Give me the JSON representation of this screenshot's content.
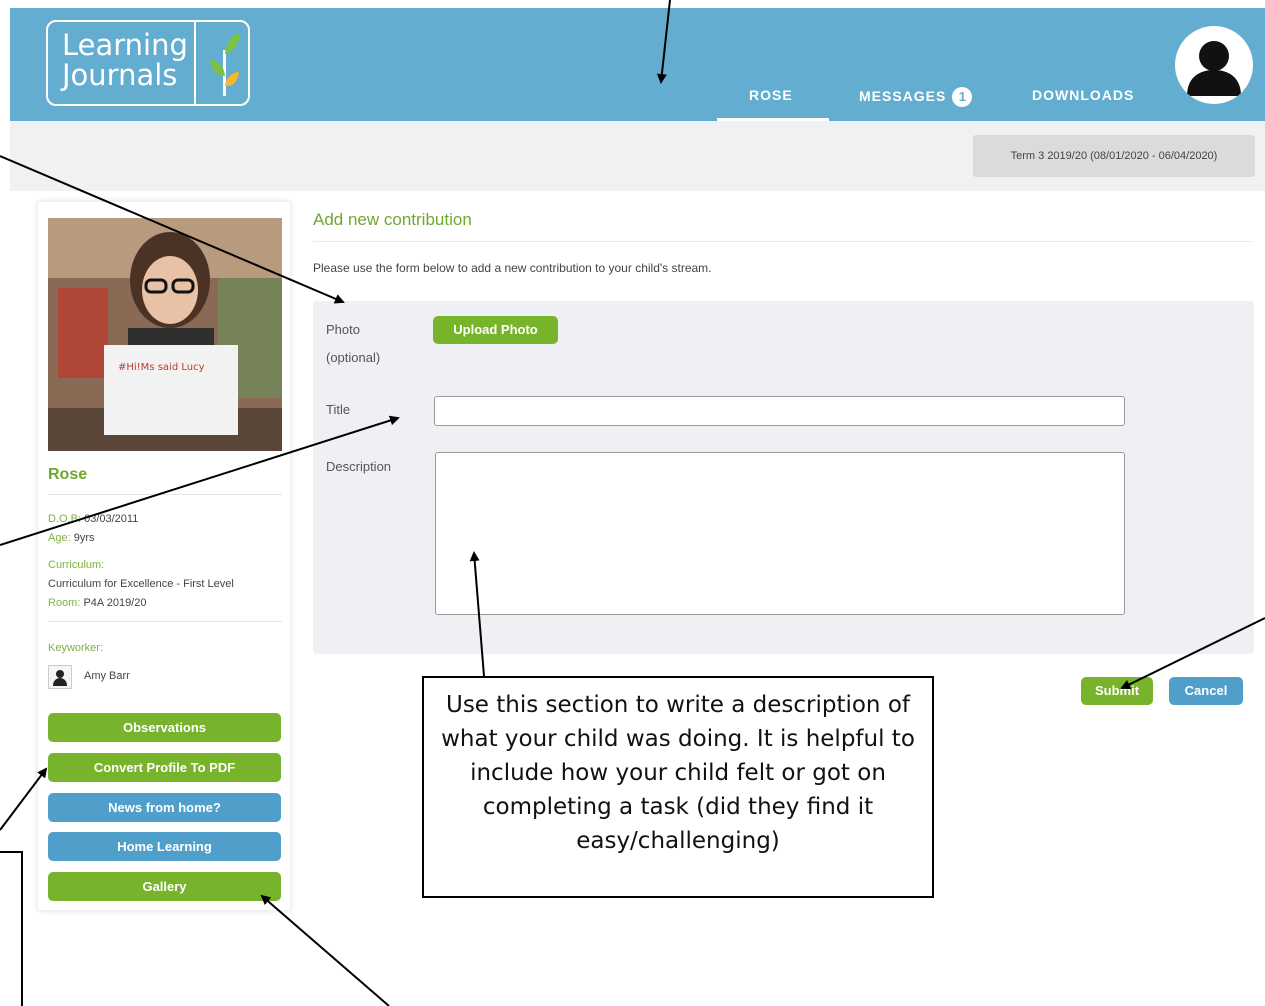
{
  "header": {
    "logo_line1": "Learning",
    "logo_line2": "Journals",
    "nav": {
      "rose": "ROSE",
      "messages": "MESSAGES",
      "messages_count": "1",
      "downloads": "DOWNLOADS"
    },
    "brand_color": "#62add0"
  },
  "term": "Term 3 2019/20 (08/01/2020 - 06/04/2020)",
  "profile": {
    "photo_text": "#Hi!Ms said Lucy",
    "name": "Rose",
    "dob_label": "D.O.B:",
    "dob": "03/03/2011",
    "age_label": "Age:",
    "age": "9yrs",
    "curriculum_label": "Curriculum:",
    "curriculum": "Curriculum for Excellence - First Level",
    "room_label": "Room:",
    "room": "P4A 2019/20",
    "keyworker_label": "Keyworker:",
    "keyworker": "Amy Barr",
    "buttons": [
      "Observations",
      "Convert Profile To PDF",
      "News from home?",
      "Home Learning",
      "Gallery"
    ]
  },
  "form": {
    "heading": "Add new contribution",
    "intro": "Please use the form below to add a new contribution to your child's stream.",
    "photo_label_1": "Photo",
    "photo_label_2": "(optional)",
    "upload_label": "Upload Photo",
    "title_label": "Title",
    "title_value": "",
    "description_label": "Description",
    "description_value": "",
    "submit_label": "Submit",
    "cancel_label": "Cancel"
  },
  "callout": "Use this section to write a description of what your child was doing. It is helpful to include how your child felt or got on completing a task (did they find it easy/challenging)",
  "colors": {
    "green": "#78b32c",
    "blue": "#4f9fca",
    "panel": "#eef0f3"
  }
}
